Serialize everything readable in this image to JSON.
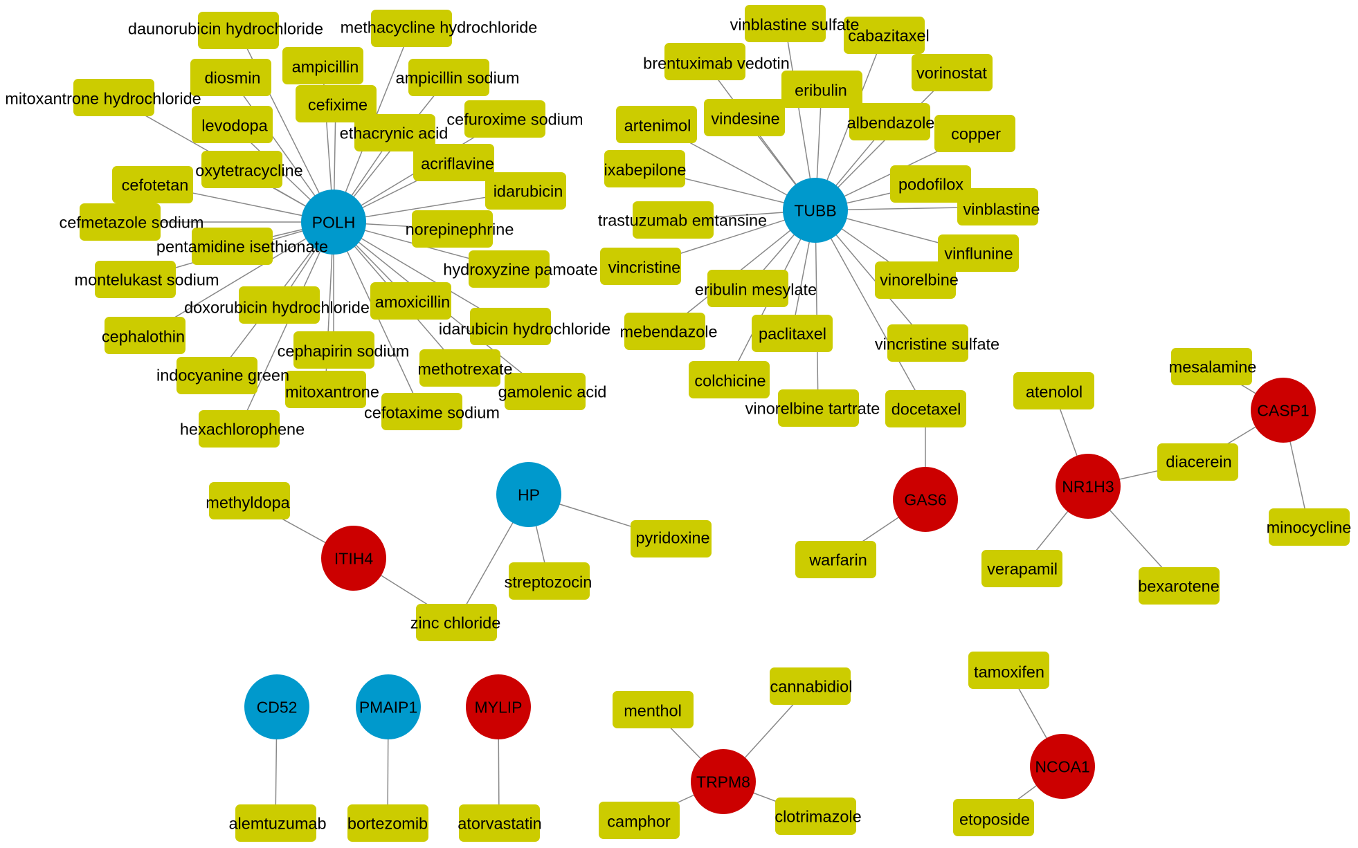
{
  "colors": {
    "gene_blue": "#0099CC",
    "gene_red": "#CC0000",
    "drug_box": "#CCCC00",
    "edge": "#888888",
    "label": "#000000"
  },
  "genes": [
    {
      "label": "POLH",
      "color": "#0099CC",
      "targets": [
        "daunorubicin hydrochloride",
        "methacycline hydrochloride",
        "diosmin",
        "ampicillin",
        "ampicillin sodium",
        "cefixime",
        "mitoxantrone hydrochloride",
        "levodopa",
        "cefuroxime sodium",
        "ethacrynic acid",
        "acriflavine",
        "oxytetracycline",
        "cefotetan",
        "idarubicin",
        "cefmetazole sodium",
        "norepinephrine",
        "pentamidine isethionate",
        "hydroxyzine pamoate",
        "montelukast sodium",
        "doxorubicin hydrochloride",
        "amoxicillin",
        "idarubicin hydrochloride",
        "cephalothin",
        "cephapirin sodium",
        "indocyanine green",
        "methotrexate",
        "mitoxantrone",
        "gamolenic acid",
        "cefotaxime sodium",
        "hexachlorophene"
      ]
    },
    {
      "label": "TUBB",
      "color": "#0099CC",
      "targets": [
        "vinblastine sulfate",
        "cabazitaxel",
        "brentuximab vedotin",
        "vorinostat",
        "eribulin",
        "artenimol",
        "vindesine",
        "albendazole",
        "copper",
        "ixabepilone",
        "podofilox",
        "vinblastine",
        "trastuzumab emtansine",
        "vincristine",
        "vinflunine",
        "eribulin mesylate",
        "vinorelbine",
        "mebendazole",
        "paclitaxel",
        "vincristine sulfate",
        "colchicine",
        "vinorelbine tartrate",
        "docetaxel"
      ]
    },
    {
      "label": "HP",
      "color": "#0099CC",
      "targets": [
        "zinc chloride",
        "streptozocin",
        "pyridoxine"
      ]
    },
    {
      "label": "ITIH4",
      "color": "#CC0000",
      "targets": [
        "methyldopa",
        "zinc chloride"
      ]
    },
    {
      "label": "GAS6",
      "color": "#CC0000",
      "targets": [
        "docetaxel",
        "warfarin"
      ]
    },
    {
      "label": "NR1H3",
      "color": "#CC0000",
      "targets": [
        "atenolol",
        "diacerein",
        "verapamil",
        "bexarotene"
      ]
    },
    {
      "label": "CASP1",
      "color": "#CC0000",
      "targets": [
        "mesalamine",
        "diacerein",
        "minocycline"
      ]
    },
    {
      "label": "CD52",
      "color": "#0099CC",
      "targets": [
        "alemtuzumab"
      ]
    },
    {
      "label": "PMAIP1",
      "color": "#0099CC",
      "targets": [
        "bortezomib"
      ]
    },
    {
      "label": "MYLIP",
      "color": "#CC0000",
      "targets": [
        "atorvastatin"
      ]
    },
    {
      "label": "TRPM8",
      "color": "#CC0000",
      "targets": [
        "menthol",
        "cannabidiol",
        "camphor",
        "clotrimazole"
      ]
    },
    {
      "label": "NCOA1",
      "color": "#CC0000",
      "targets": [
        "tamoxifen",
        "etoposide"
      ]
    }
  ],
  "drugs": [
    {
      "label": "daunorubicin hydrochloride"
    },
    {
      "label": "methacycline hydrochloride"
    },
    {
      "label": "diosmin"
    },
    {
      "label": "ampicillin"
    },
    {
      "label": "ampicillin sodium"
    },
    {
      "label": "cefixime"
    },
    {
      "label": "mitoxantrone hydrochloride"
    },
    {
      "label": "levodopa"
    },
    {
      "label": "cefuroxime sodium"
    },
    {
      "label": "ethacrynic acid"
    },
    {
      "label": "acriflavine"
    },
    {
      "label": "oxytetracycline"
    },
    {
      "label": "cefotetan"
    },
    {
      "label": "idarubicin"
    },
    {
      "label": "cefmetazole sodium"
    },
    {
      "label": "norepinephrine"
    },
    {
      "label": "pentamidine isethionate"
    },
    {
      "label": "hydroxyzine pamoate"
    },
    {
      "label": "montelukast sodium"
    },
    {
      "label": "doxorubicin hydrochloride"
    },
    {
      "label": "amoxicillin"
    },
    {
      "label": "idarubicin hydrochloride"
    },
    {
      "label": "cephalothin"
    },
    {
      "label": "cephapirin sodium"
    },
    {
      "label": "indocyanine green"
    },
    {
      "label": "methotrexate"
    },
    {
      "label": "mitoxantrone"
    },
    {
      "label": "gamolenic acid"
    },
    {
      "label": "cefotaxime sodium"
    },
    {
      "label": "hexachlorophene"
    },
    {
      "label": "vinblastine sulfate"
    },
    {
      "label": "cabazitaxel"
    },
    {
      "label": "brentuximab vedotin"
    },
    {
      "label": "vorinostat"
    },
    {
      "label": "eribulin"
    },
    {
      "label": "artenimol"
    },
    {
      "label": "vindesine"
    },
    {
      "label": "albendazole"
    },
    {
      "label": "copper"
    },
    {
      "label": "ixabepilone"
    },
    {
      "label": "podofilox"
    },
    {
      "label": "vinblastine"
    },
    {
      "label": "trastuzumab emtansine"
    },
    {
      "label": "vincristine"
    },
    {
      "label": "vinflunine"
    },
    {
      "label": "eribulin mesylate"
    },
    {
      "label": "vinorelbine"
    },
    {
      "label": "mebendazole"
    },
    {
      "label": "paclitaxel"
    },
    {
      "label": "vincristine sulfate"
    },
    {
      "label": "colchicine"
    },
    {
      "label": "vinorelbine tartrate"
    },
    {
      "label": "docetaxel"
    },
    {
      "label": "methyldopa"
    },
    {
      "label": "zinc chloride"
    },
    {
      "label": "streptozocin"
    },
    {
      "label": "pyridoxine"
    },
    {
      "label": "warfarin"
    },
    {
      "label": "atenolol"
    },
    {
      "label": "diacerein"
    },
    {
      "label": "verapamil"
    },
    {
      "label": "bexarotene"
    },
    {
      "label": "mesalamine"
    },
    {
      "label": "minocycline"
    },
    {
      "label": "alemtuzumab"
    },
    {
      "label": "bortezomib"
    },
    {
      "label": "atorvastatin"
    },
    {
      "label": "menthol"
    },
    {
      "label": "cannabidiol"
    },
    {
      "label": "camphor"
    },
    {
      "label": "clotrimazole"
    },
    {
      "label": "tamoxifen"
    },
    {
      "label": "etoposide"
    }
  ]
}
